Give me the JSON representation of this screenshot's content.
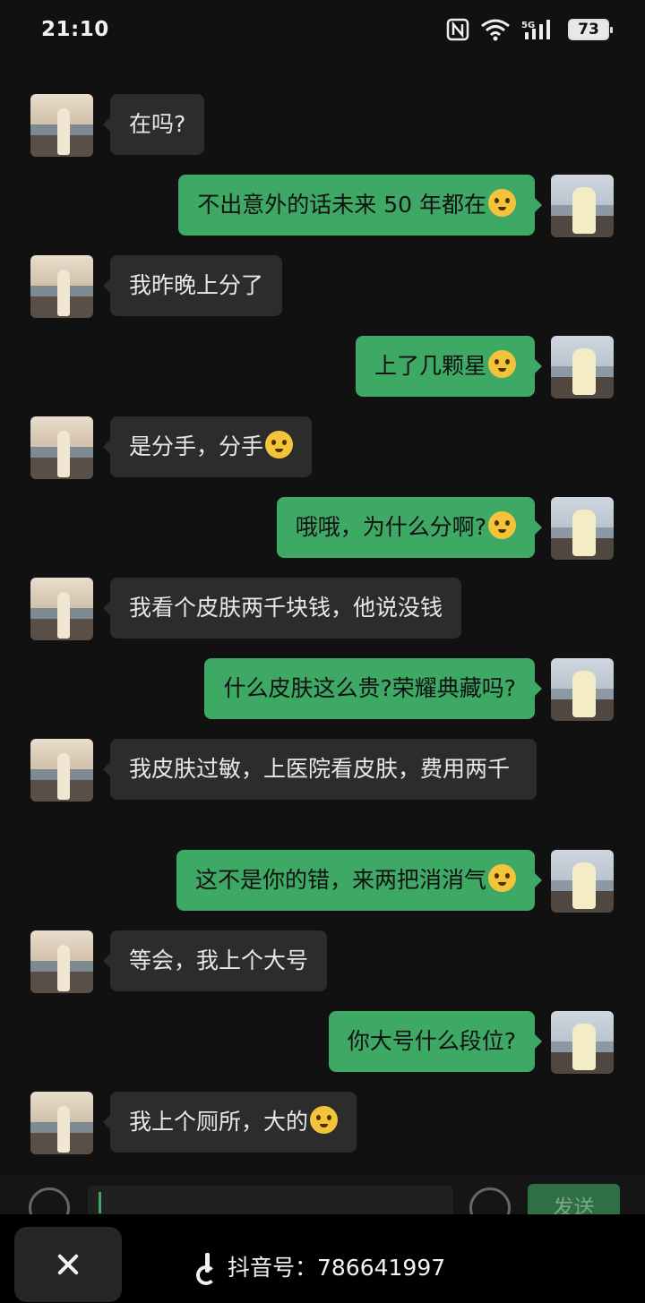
{
  "status_bar": {
    "time": "21:10",
    "network": "5G",
    "battery": "73",
    "icons": [
      "nfc-icon",
      "wifi-icon",
      "signal-icon",
      "battery-icon"
    ]
  },
  "messages": [
    {
      "side": "left",
      "text": "在吗?",
      "emoji": false
    },
    {
      "side": "right",
      "text": "不出意外的话未来 50 年都在",
      "emoji": true
    },
    {
      "side": "left",
      "text": "我昨晚上分了",
      "emoji": false
    },
    {
      "side": "right",
      "text": "上了几颗星",
      "emoji": true
    },
    {
      "side": "left",
      "text": "是分手，分手",
      "emoji": true
    },
    {
      "side": "right",
      "text": "哦哦，为什么分啊?",
      "emoji": true
    },
    {
      "side": "left",
      "text": "我看个皮肤两千块钱，他说没钱",
      "emoji": false
    },
    {
      "side": "right",
      "text": "什么皮肤这么贵?荣耀典藏吗?",
      "emoji": false
    },
    {
      "side": "left",
      "text": "我皮肤过敏，上医院看皮肤，费用两千",
      "emoji": false
    },
    {
      "side": "right",
      "text": "这不是你的错，来两把消消气",
      "emoji": true
    },
    {
      "side": "left",
      "text": "等会，我上个大号",
      "emoji": false
    },
    {
      "side": "right",
      "text": "你大号什么段位?",
      "emoji": false
    },
    {
      "side": "left",
      "text": "我上个厕所，大的",
      "emoji": true
    }
  ],
  "input_bar": {
    "send_label": "发送",
    "colors": {
      "send": "#2f6f45"
    }
  },
  "bottom_bar": {
    "watermark": "抖音号：786641997"
  },
  "colors": {
    "background": "#111111",
    "outgoing_bubble": "#3ea865",
    "incoming_bubble": "#2c2c2c"
  }
}
